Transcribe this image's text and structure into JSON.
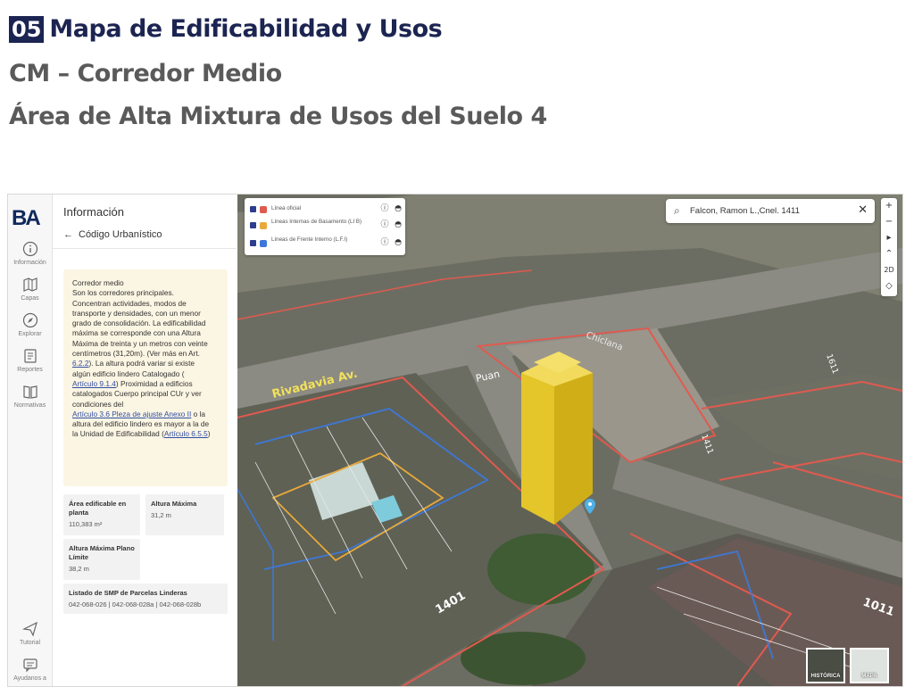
{
  "slide": {
    "number": "05",
    "title": "Mapa de Edificabilidad y Usos",
    "subtitle": "CM – Corredor Medio",
    "subtitle2": "Área de Alta Mixtura de Usos del Suelo 4"
  },
  "sidebar": {
    "logo": "BA",
    "items": [
      {
        "label": "Información",
        "icon": "info-icon"
      },
      {
        "label": "Capas",
        "icon": "map-layers-icon"
      },
      {
        "label": "Explorar",
        "icon": "compass-icon"
      },
      {
        "label": "Reportes",
        "icon": "report-icon"
      },
      {
        "label": "Normativas",
        "icon": "book-icon"
      },
      {
        "label": "Tutorial",
        "icon": "send-icon"
      },
      {
        "label": "Ayudanos a",
        "icon": "chat-icon"
      }
    ]
  },
  "panel": {
    "title": "Información",
    "back_label": "Código Urbanístico",
    "info": {
      "heading": "Corredor medio",
      "line1": "Son los corredores principales.",
      "line2": "Concentran actividades, modos de",
      "line3": "transporte y densidades, con un menor",
      "line4": "grado de consolidación. La edificabilidad",
      "line5": "máxima se corresponde con una Altura",
      "line6": "Máxima de treinta y un metros con veinte",
      "line7": "centímetros (31,20m). (Ver más en Art.",
      "link1": "6.2.2",
      "line8": "). La altura podrá variar si existe",
      "line9": "algún edificio lindero Catalogado (",
      "link2": "Artículo 9.1.4",
      "line10": ") Proximidad a edificios",
      "line11": "catalogados Cuerpo principal CUr y ver",
      "line12": "condiciones del",
      "link3": "Artículo 3.6 Pleza de ajuste Anexo II",
      "line13": " o la",
      "line14": "altura del edificio lindero es mayor a la de",
      "line15": "la Unidad de Edificabilidad (",
      "link4": "Artículo 6.5.5",
      "line16": ")"
    },
    "cards": {
      "area_label": "Área edificable en planta",
      "area_value": "110,383 m²",
      "altura_label": "Altura Máxima",
      "altura_value": "31,2 m",
      "plano_label": "Altura Máxima Plano Límite",
      "plano_value": "38,2 m",
      "smp_label": "Listado de SMP de Parcelas Linderas",
      "smp_value": "042-068-026 | 042-068-028a | 042-068-028b"
    }
  },
  "map": {
    "search_value": "Falcon, Ramon L.,Cnel. 1411",
    "legend": [
      {
        "label": "Línea oficial",
        "color": "#e05a4f"
      },
      {
        "label": "Líneas Internas de Basamento (LI B)",
        "color": "#e8a93a"
      },
      {
        "label": "Líneas de Frente Interno (L.F.I)",
        "color": "#3d78d8"
      }
    ],
    "controls": [
      "+",
      "−",
      "▸",
      "⌃",
      "2D",
      "◇"
    ],
    "street_labels": {
      "rivadavia": "Rivadavia Av.",
      "puan": "Puan",
      "chiclana": "Chiclana",
      "n1401": "1401",
      "n1411": "1411",
      "n1011": "1011",
      "n1611": "1611"
    },
    "thumbs": {
      "historica": "HISTÓRICA",
      "mapa": "MAPA"
    }
  },
  "colors": {
    "navy": "#1c2451",
    "legend_red": "#e05a4f",
    "legend_orange": "#e8a93a",
    "legend_blue": "#3d78d8",
    "building_yellow": "#e4c52a"
  }
}
